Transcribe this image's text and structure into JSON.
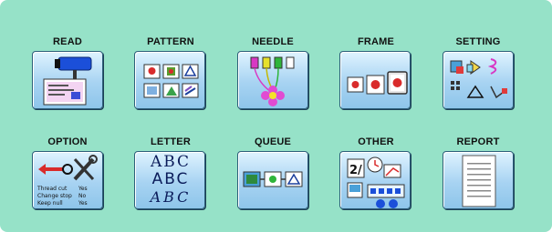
{
  "menu": {
    "read": "READ",
    "pattern": "PATTERN",
    "needle": "NEEDLE",
    "frame": "FRAME",
    "setting": "SETTING",
    "option": "OPTION",
    "letter": "LETTER",
    "queue": "QUEUE",
    "other": "OTHER",
    "report": "REPORT"
  },
  "option_icon": {
    "lines": [
      {
        "label": "Thread cut",
        "value": "Yes"
      },
      {
        "label": "Change stop",
        "value": "No"
      },
      {
        "label": "Keep null",
        "value": "Yes"
      }
    ]
  },
  "letter_icon": {
    "line1": "ABC",
    "line2": "ABC",
    "line3": "ABC"
  },
  "colors": {
    "background": "#96e2c8",
    "button_top": "#dff3ff",
    "button_bottom": "#8ec5ea",
    "border": "#2d5f7a"
  }
}
